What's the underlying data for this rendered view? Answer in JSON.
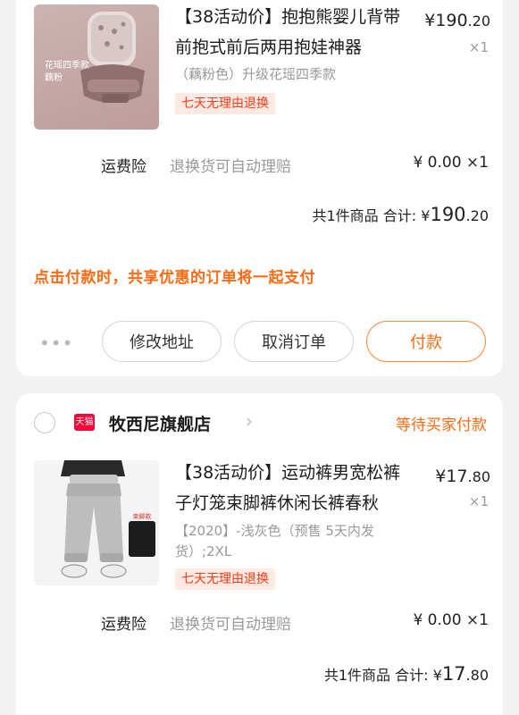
{
  "order1": {
    "item": {
      "title": "【38活动价】抱抱熊婴儿背带前抱式前后两用抱娃神器",
      "price_symbol": "¥",
      "price_int": "190",
      "price_dec": ".20",
      "qty": "×1",
      "spec": "（藕粉色）升级花瑶四季款",
      "tag": "七天无理由退换",
      "thumb_caption_1": "花瑶四季款",
      "thumb_caption_2": "藕粉"
    },
    "insurance": {
      "label": "运费险",
      "desc": "退换货可自动理赔",
      "price": "¥ 0.00 ×1"
    },
    "summary": {
      "count_text": "共1件商品",
      "total_label": "合计:",
      "symbol": "¥",
      "int": "190",
      "dec": ".20"
    },
    "notice": "点击付款时，共享优惠的订单将一起支付",
    "actions": {
      "more": "•••",
      "edit_address": "修改地址",
      "cancel_order": "取消订单",
      "pay": "付款"
    }
  },
  "order2": {
    "store": {
      "badge": "天猫",
      "name": "牧西尼旗舰店",
      "chevron": "›",
      "status": "等待买家付款"
    },
    "item": {
      "title": "【38活动价】运动裤男宽松裤子灯笼束脚裤休闲长裤春秋",
      "price_symbol": "¥",
      "price_int": "17",
      "price_dec": ".80",
      "qty": "×1",
      "spec": "【2020】-浅灰色（预售 5天内发货）;2XL",
      "tag": "七天无理由退换",
      "thumb_caption": "束脚款"
    },
    "insurance": {
      "label": "运费险",
      "desc": "退换货可自动理赔",
      "price": "¥ 0.00 ×1"
    },
    "summary": {
      "count_text": "共1件商品",
      "total_label": "合计:",
      "symbol": "¥",
      "int": "17",
      "dec": ".80"
    }
  },
  "colors": {
    "accent": "#ff6a13",
    "tag_red": "#ff3b16",
    "tmall_red": "#ff0036",
    "background": "#f2f2f2"
  }
}
